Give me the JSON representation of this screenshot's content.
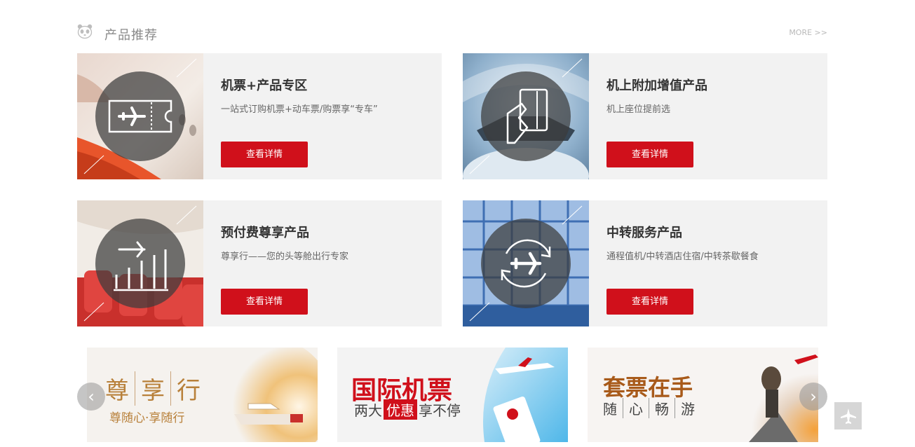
{
  "section": {
    "title": "产品推荐",
    "more": "MORE >>"
  },
  "cards": [
    {
      "title": "机票+产品专区",
      "desc": "一站式订购机票+动车票/购票享“专车”",
      "button": "查看详情",
      "icon": "ticket-icon"
    },
    {
      "title": "机上附加增值产品",
      "desc": "机上座位提前选",
      "button": "查看详情",
      "icon": "seat-card-icon"
    },
    {
      "title": "预付费尊享产品",
      "desc": "尊享行——您的头等舱出行专家",
      "button": "查看详情",
      "icon": "plane-chart-icon"
    },
    {
      "title": "中转服务产品",
      "desc": "通程值机/中转酒店住宿/中转茶歇餐食",
      "button": "查看详情",
      "icon": "transfer-cycle-icon"
    }
  ],
  "banners": [
    {
      "chars": [
        "尊",
        "享",
        "行"
      ],
      "subtitle": "尊随心·享随行"
    },
    {
      "title": "国际机票",
      "line_a": "两大",
      "line_b": "优惠",
      "line_c": "享不停"
    },
    {
      "title": "套票在手",
      "chars": [
        "随",
        "心",
        "畅",
        "游"
      ]
    }
  ],
  "nav": {
    "prev": "‹",
    "next": "›"
  },
  "colors": {
    "brand_red": "#d0101b",
    "card_bg": "#f2f2f2"
  }
}
